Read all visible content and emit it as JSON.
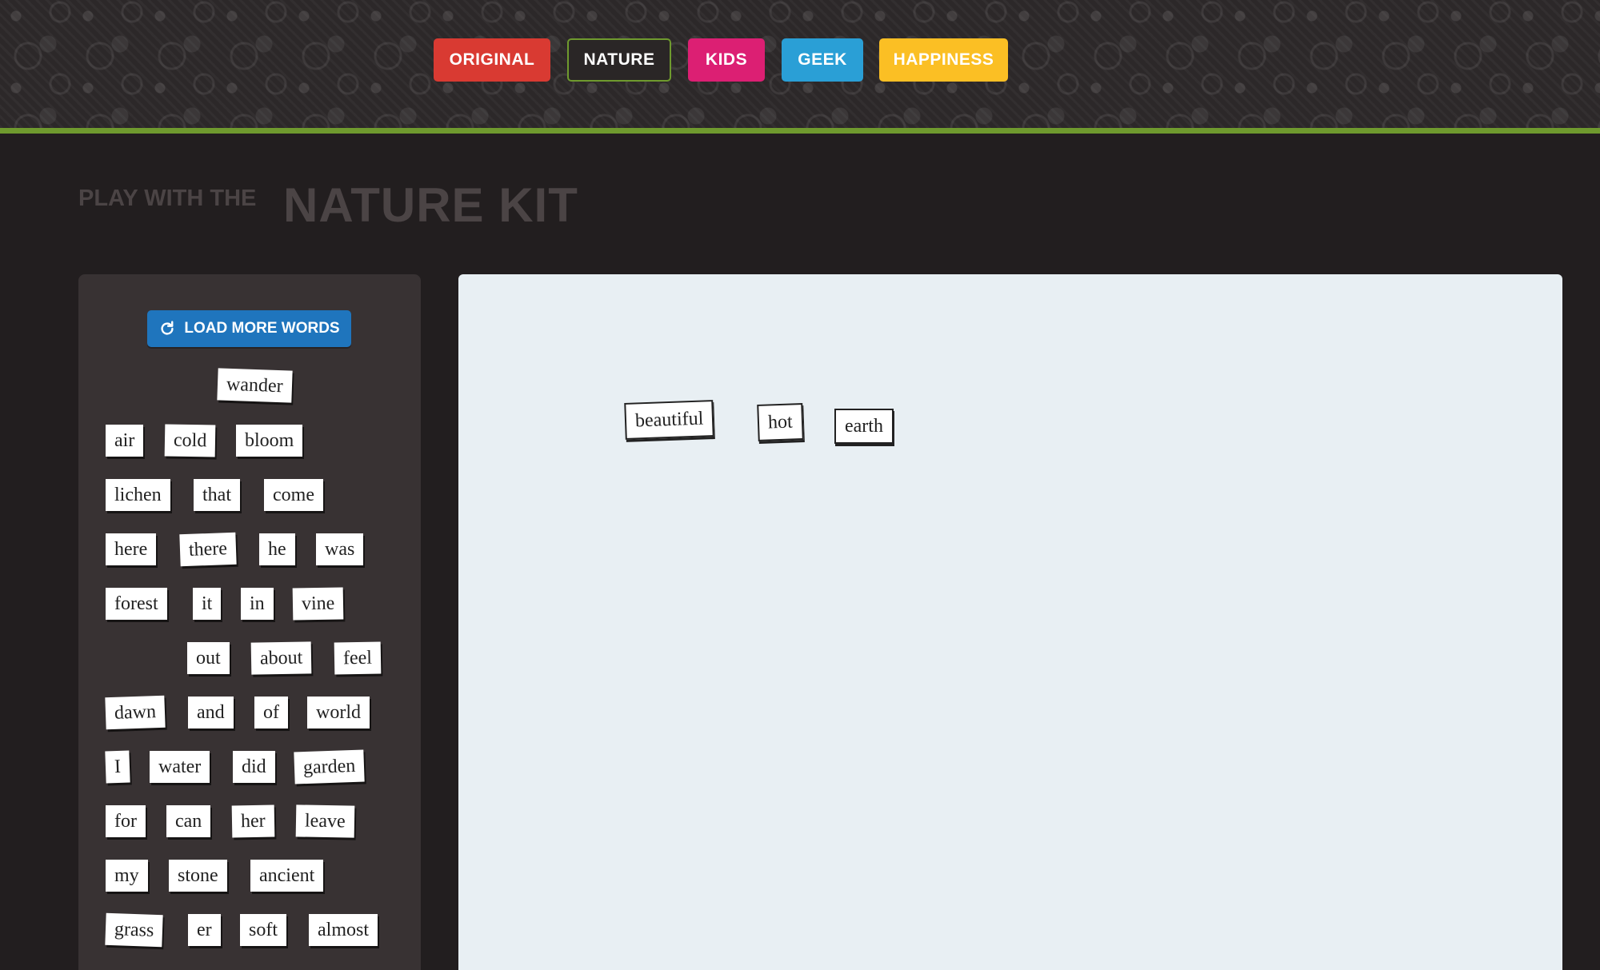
{
  "nav": {
    "original": "ORIGINAL",
    "nature": "NATURE",
    "kids": "KIDS",
    "geek": "GEEK",
    "happiness": "HAPPINESS"
  },
  "title": {
    "small": "PLAY WITH THE",
    "big": "NATURE KIT"
  },
  "sidebar": {
    "load_more_label": "LOAD MORE WORDS",
    "words": [
      "wander",
      "air",
      "cold",
      "bloom",
      "lichen",
      "that",
      "come",
      "here",
      "there",
      "he",
      "was",
      "forest",
      "it",
      "in",
      "vine",
      "out",
      "about",
      "feel",
      "dawn",
      "and",
      "of",
      "world",
      "I",
      "water",
      "did",
      "garden",
      "for",
      "can",
      "her",
      "leave",
      "my",
      "stone",
      "ancient",
      "grass",
      "er",
      "soft",
      "almost"
    ]
  },
  "canvas": {
    "words": [
      "beautiful",
      "hot",
      "earth"
    ]
  },
  "colors": {
    "original": "#d93a32",
    "nature_border": "#6f9a2e",
    "kids": "#dc1f73",
    "geek": "#2a9fd6",
    "happiness": "#fbbf24",
    "load_button": "#1f75bd"
  },
  "icons": {
    "load_more": "refresh-icon"
  }
}
